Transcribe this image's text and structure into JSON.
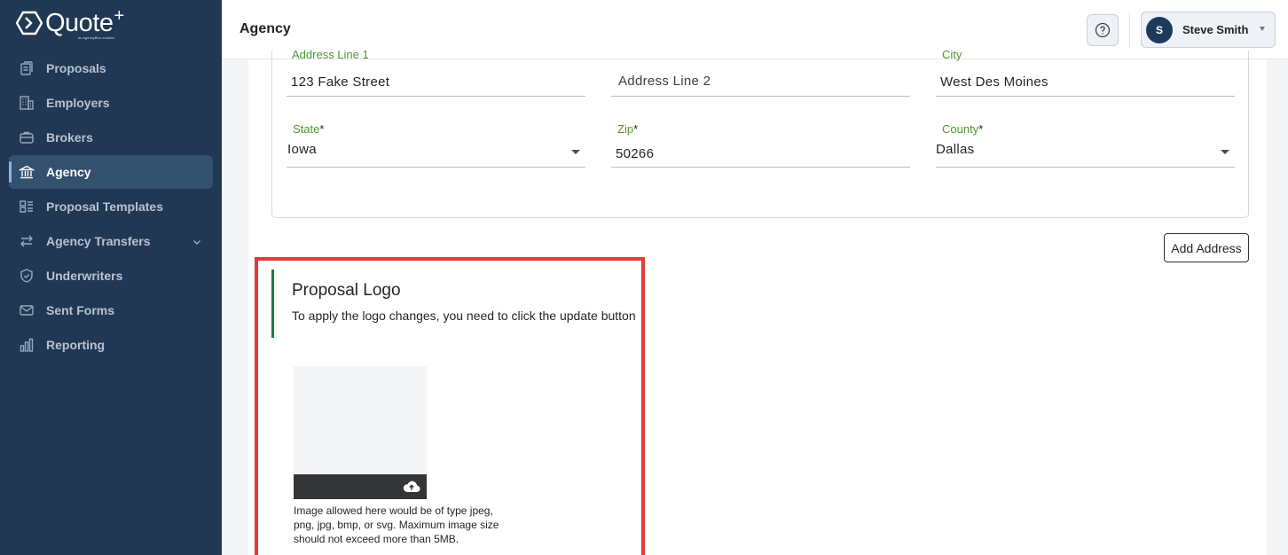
{
  "app": {
    "logo_text": "Quote",
    "logo_plus": "+",
    "logo_tagline": "an AgencyBloc solution"
  },
  "sidebar": {
    "items": [
      {
        "label": "Proposals",
        "icon": "proposals-icon"
      },
      {
        "label": "Employers",
        "icon": "building-icon"
      },
      {
        "label": "Brokers",
        "icon": "briefcase-icon"
      },
      {
        "label": "Agency",
        "icon": "bank-icon",
        "active": true
      },
      {
        "label": "Proposal Templates",
        "icon": "templates-icon"
      },
      {
        "label": "Agency Transfers",
        "icon": "transfer-icon",
        "has_chevron": true
      },
      {
        "label": "Underwriters",
        "icon": "shield-icon"
      },
      {
        "label": "Sent Forms",
        "icon": "mail-icon"
      },
      {
        "label": "Reporting",
        "icon": "bar-chart-icon"
      }
    ]
  },
  "header": {
    "title": "Agency",
    "user": {
      "initial": "S",
      "name": "Steve Smith"
    }
  },
  "address": {
    "line1": {
      "label": "Address Line 1",
      "value": "123 Fake Street"
    },
    "line2": {
      "placeholder": "Address Line 2"
    },
    "city": {
      "label": "City",
      "value": "West Des Moines"
    },
    "state": {
      "label": "State",
      "required": "*",
      "value": "Iowa"
    },
    "zip": {
      "label": "Zip",
      "required": "*",
      "value": "50266"
    },
    "county": {
      "label": "County",
      "required": "*",
      "value": "Dallas"
    },
    "add_button": "Add Address"
  },
  "proposal_logo": {
    "title": "Proposal Logo",
    "subtitle": "To apply the logo changes, you need to click the update button",
    "upload_note": "Image allowed here would be of type jpeg, png, jpg, bmp, or svg. Maximum image size should not exceed more than 5MB."
  },
  "colors": {
    "sidebar_bg": "#213854",
    "active_item_bg": "#34506f",
    "label_green": "#4c9a2a",
    "section_accent": "#1c7a3c",
    "highlight_red": "#e23b3b"
  }
}
